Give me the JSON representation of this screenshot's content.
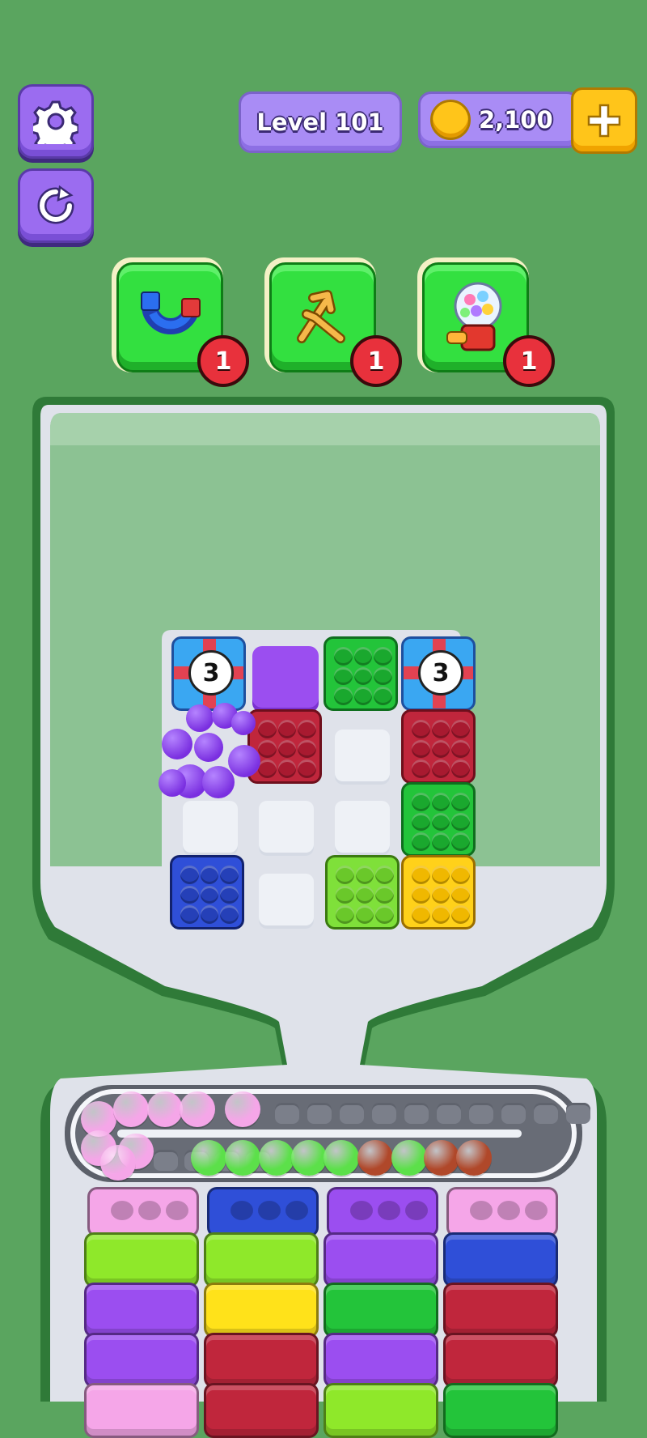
{
  "header": {
    "level_label": "Level 101",
    "coins": "2,100"
  },
  "boosters": [
    {
      "icon": "magnet-icon",
      "count": "1"
    },
    {
      "icon": "swap-arrows-icon",
      "count": "1"
    },
    {
      "icon": "gumball-machine-icon",
      "count": "1"
    }
  ],
  "board": {
    "gift_counts": [
      "3",
      "3"
    ],
    "tile_colors": {
      "purple": "#9b4ef0",
      "green": "#23c43a",
      "red": "#c0263c",
      "blue": "#2f4fd8",
      "lime": "#7fe03a",
      "yellow": "#ffd11a"
    }
  },
  "colors": {
    "background": "#5aa55f",
    "accent_purple": "#9b6cf0",
    "coin_gold": "#ffc51a"
  }
}
